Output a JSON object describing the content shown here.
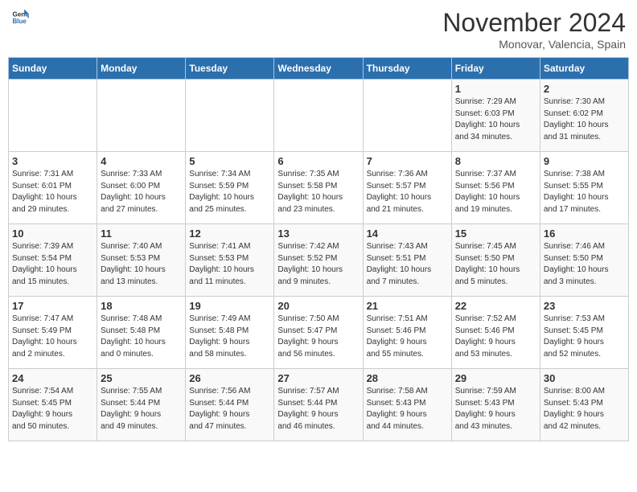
{
  "header": {
    "logo_general": "General",
    "logo_blue": "Blue",
    "month": "November 2024",
    "location": "Monovar, Valencia, Spain"
  },
  "weekdays": [
    "Sunday",
    "Monday",
    "Tuesday",
    "Wednesday",
    "Thursday",
    "Friday",
    "Saturday"
  ],
  "weeks": [
    [
      {
        "day": "",
        "info": ""
      },
      {
        "day": "",
        "info": ""
      },
      {
        "day": "",
        "info": ""
      },
      {
        "day": "",
        "info": ""
      },
      {
        "day": "",
        "info": ""
      },
      {
        "day": "1",
        "info": "Sunrise: 7:29 AM\nSunset: 6:03 PM\nDaylight: 10 hours\nand 34 minutes."
      },
      {
        "day": "2",
        "info": "Sunrise: 7:30 AM\nSunset: 6:02 PM\nDaylight: 10 hours\nand 31 minutes."
      }
    ],
    [
      {
        "day": "3",
        "info": "Sunrise: 7:31 AM\nSunset: 6:01 PM\nDaylight: 10 hours\nand 29 minutes."
      },
      {
        "day": "4",
        "info": "Sunrise: 7:33 AM\nSunset: 6:00 PM\nDaylight: 10 hours\nand 27 minutes."
      },
      {
        "day": "5",
        "info": "Sunrise: 7:34 AM\nSunset: 5:59 PM\nDaylight: 10 hours\nand 25 minutes."
      },
      {
        "day": "6",
        "info": "Sunrise: 7:35 AM\nSunset: 5:58 PM\nDaylight: 10 hours\nand 23 minutes."
      },
      {
        "day": "7",
        "info": "Sunrise: 7:36 AM\nSunset: 5:57 PM\nDaylight: 10 hours\nand 21 minutes."
      },
      {
        "day": "8",
        "info": "Sunrise: 7:37 AM\nSunset: 5:56 PM\nDaylight: 10 hours\nand 19 minutes."
      },
      {
        "day": "9",
        "info": "Sunrise: 7:38 AM\nSunset: 5:55 PM\nDaylight: 10 hours\nand 17 minutes."
      }
    ],
    [
      {
        "day": "10",
        "info": "Sunrise: 7:39 AM\nSunset: 5:54 PM\nDaylight: 10 hours\nand 15 minutes."
      },
      {
        "day": "11",
        "info": "Sunrise: 7:40 AM\nSunset: 5:53 PM\nDaylight: 10 hours\nand 13 minutes."
      },
      {
        "day": "12",
        "info": "Sunrise: 7:41 AM\nSunset: 5:53 PM\nDaylight: 10 hours\nand 11 minutes."
      },
      {
        "day": "13",
        "info": "Sunrise: 7:42 AM\nSunset: 5:52 PM\nDaylight: 10 hours\nand 9 minutes."
      },
      {
        "day": "14",
        "info": "Sunrise: 7:43 AM\nSunset: 5:51 PM\nDaylight: 10 hours\nand 7 minutes."
      },
      {
        "day": "15",
        "info": "Sunrise: 7:45 AM\nSunset: 5:50 PM\nDaylight: 10 hours\nand 5 minutes."
      },
      {
        "day": "16",
        "info": "Sunrise: 7:46 AM\nSunset: 5:50 PM\nDaylight: 10 hours\nand 3 minutes."
      }
    ],
    [
      {
        "day": "17",
        "info": "Sunrise: 7:47 AM\nSunset: 5:49 PM\nDaylight: 10 hours\nand 2 minutes."
      },
      {
        "day": "18",
        "info": "Sunrise: 7:48 AM\nSunset: 5:48 PM\nDaylight: 10 hours\nand 0 minutes."
      },
      {
        "day": "19",
        "info": "Sunrise: 7:49 AM\nSunset: 5:48 PM\nDaylight: 9 hours\nand 58 minutes."
      },
      {
        "day": "20",
        "info": "Sunrise: 7:50 AM\nSunset: 5:47 PM\nDaylight: 9 hours\nand 56 minutes."
      },
      {
        "day": "21",
        "info": "Sunrise: 7:51 AM\nSunset: 5:46 PM\nDaylight: 9 hours\nand 55 minutes."
      },
      {
        "day": "22",
        "info": "Sunrise: 7:52 AM\nSunset: 5:46 PM\nDaylight: 9 hours\nand 53 minutes."
      },
      {
        "day": "23",
        "info": "Sunrise: 7:53 AM\nSunset: 5:45 PM\nDaylight: 9 hours\nand 52 minutes."
      }
    ],
    [
      {
        "day": "24",
        "info": "Sunrise: 7:54 AM\nSunset: 5:45 PM\nDaylight: 9 hours\nand 50 minutes."
      },
      {
        "day": "25",
        "info": "Sunrise: 7:55 AM\nSunset: 5:44 PM\nDaylight: 9 hours\nand 49 minutes."
      },
      {
        "day": "26",
        "info": "Sunrise: 7:56 AM\nSunset: 5:44 PM\nDaylight: 9 hours\nand 47 minutes."
      },
      {
        "day": "27",
        "info": "Sunrise: 7:57 AM\nSunset: 5:44 PM\nDaylight: 9 hours\nand 46 minutes."
      },
      {
        "day": "28",
        "info": "Sunrise: 7:58 AM\nSunset: 5:43 PM\nDaylight: 9 hours\nand 44 minutes."
      },
      {
        "day": "29",
        "info": "Sunrise: 7:59 AM\nSunset: 5:43 PM\nDaylight: 9 hours\nand 43 minutes."
      },
      {
        "day": "30",
        "info": "Sunrise: 8:00 AM\nSunset: 5:43 PM\nDaylight: 9 hours\nand 42 minutes."
      }
    ]
  ]
}
